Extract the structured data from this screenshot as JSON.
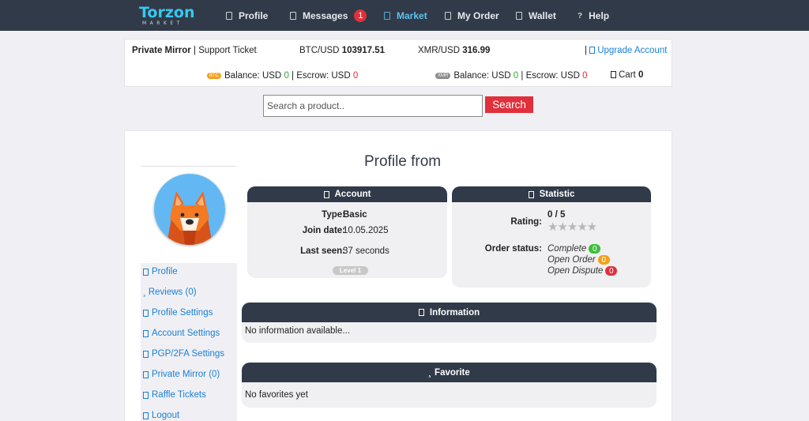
{
  "brand": {
    "name": "Torzon",
    "sub": "MARKET"
  },
  "nav": {
    "profile": "Profile",
    "messages": "Messages",
    "messages_count": "1",
    "market": "Market",
    "my_order": "My Order",
    "wallet": "Wallet",
    "help": "Help",
    "help_glyph": "?"
  },
  "infobar": {
    "private_mirror": "Private Mirror",
    "separator": "|",
    "support_ticket": "Support Ticket",
    "btc_label": "BTC/USD",
    "btc_value": "103917.51",
    "xmr_label": "XMR/USD",
    "xmr_value": "316.99",
    "upgrade": "Upgrade Account",
    "btc_tag": "BTC",
    "xmr_tag": "XMR",
    "balance_label": "Balance: USD",
    "escrow_label": "Escrow: USD",
    "btc_balance": "0",
    "btc_escrow": "0",
    "xmr_balance": "0",
    "xmr_escrow": "0",
    "cart_label": "Cart",
    "cart_count": "0"
  },
  "search": {
    "placeholder": "Search a product..",
    "button": "Search"
  },
  "sidebar": {
    "items": [
      {
        "label": "Profile"
      },
      {
        "label": "Reviews (0)"
      },
      {
        "label": "Profile Settings"
      },
      {
        "label": "Account Settings"
      },
      {
        "label": "PGP/2FA Settings"
      },
      {
        "label": "Private Mirror (0)"
      },
      {
        "label": "Raffle Tickets"
      },
      {
        "label": "Logout"
      }
    ]
  },
  "page": {
    "title": "Profile from"
  },
  "account": {
    "heading": "Account",
    "type_label": "Type:",
    "type_value": "Basic",
    "join_label": "Join date:",
    "join_value": "10.05.2025",
    "seen_label": "Last seen:",
    "seen_value": "37 seconds",
    "level": "Level 1"
  },
  "statistic": {
    "heading": "Statistic",
    "rating_label": "Rating:",
    "rating_value": "0 / 5",
    "rating_stars": 0,
    "stars": "★★★★★",
    "order_status_label": "Order status:",
    "complete_label": "Complete",
    "complete_count": "0",
    "open_label": "Open Order",
    "open_count": "0",
    "dispute_label": "Open Dispute",
    "dispute_count": "0"
  },
  "information": {
    "heading": "Information",
    "text": "No information available..."
  },
  "favorite": {
    "heading": "Favorite",
    "text": "No favorites yet",
    "glyph": "¸"
  },
  "colors": {
    "nav_bg": "#313a48",
    "accent_blue": "#1a7fd6",
    "danger": "#e0303b",
    "success": "#3cbf3c",
    "warning": "#f2a11a"
  }
}
